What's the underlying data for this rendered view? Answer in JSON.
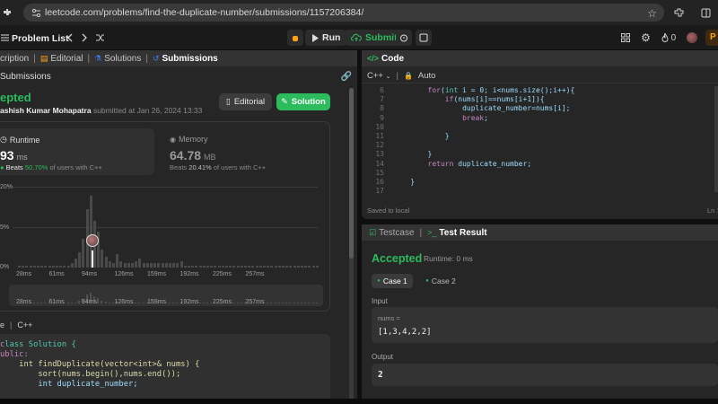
{
  "browser": {
    "url": "leetcode.com/problems/find-the-duplicate-number/submissions/1157206384/"
  },
  "header": {
    "problem_list": "Problem List",
    "run": "Run",
    "submit": "Submit"
  },
  "left_tabs": {
    "description": "cription",
    "editorial": "Editorial",
    "solutions": "Solutions",
    "submissions": "Submissions",
    "sub_heading": "Submissions"
  },
  "result": {
    "status": "epted",
    "author": "ashish Kumar Mohapatra",
    "submitted_text": "submitted at Jan 26, 2024 13:33",
    "editorial_btn": "Editorial",
    "solution_btn": "Solution"
  },
  "runtime": {
    "label": "Runtime",
    "value": "93",
    "unit": "ms",
    "beats_prefix": "Beats",
    "beats_pct": "50.70%",
    "beats_suffix": "of users with C++"
  },
  "memory": {
    "label": "Memory",
    "value": "64.78",
    "unit": "MB",
    "beats_prefix": "Beats",
    "beats_pct": "20.41%",
    "beats_suffix": "of users with C++"
  },
  "histogram": {
    "y_ticks": [
      "20%",
      "5%",
      "0%"
    ],
    "x_ticks": [
      "28ms",
      "61ms",
      "94ms",
      "126ms",
      "159ms",
      "192ms",
      "225ms",
      "257ms"
    ],
    "minimap_ticks": [
      "28ms",
      "61ms",
      "94ms",
      "126ms",
      "159ms",
      "192ms",
      "225ms",
      "257ms"
    ],
    "bar_values": [
      1,
      1,
      1,
      1,
      1,
      1,
      1,
      1,
      1,
      1,
      1,
      1,
      1,
      1,
      2,
      4,
      7,
      13,
      26,
      32,
      21,
      16,
      8,
      5,
      3,
      2,
      6,
      3,
      2,
      2,
      2,
      3,
      4,
      2,
      2,
      2,
      2,
      2,
      2,
      2,
      2,
      2,
      2,
      3,
      1,
      1,
      1,
      1,
      1,
      1,
      1,
      1,
      1,
      1,
      1,
      1,
      1,
      1,
      1,
      1,
      1,
      1,
      1,
      1,
      1,
      1,
      1,
      1,
      1,
      1,
      1,
      1,
      1,
      1,
      1,
      1,
      1,
      1,
      1,
      1
    ]
  },
  "left_code": {
    "lang_prev": "e",
    "lang": "C++",
    "lines": [
      "lass Solution {",
      "ublic:",
      "    int findDuplicate(vector<int>& nums) {",
      "        sort(nums.begin(),nums.end());",
      "        int duplicate_number;"
    ]
  },
  "code_panel": {
    "title": "Code",
    "lang": "C++",
    "mode": "Auto",
    "saved": "Saved to local",
    "pos": "Ln 1",
    "line_numbers": [
      "6",
      "7",
      "8",
      "9",
      "10",
      "11",
      "12",
      "13",
      "14",
      "15",
      "16",
      "17"
    ],
    "lines": [
      "        for(int i = 0; i<nums.size();i++){",
      "            if(nums[i]==nums[i+1]){",
      "                duplicate_number=nums[i];",
      "                break;",
      "",
      "            }",
      "",
      "        }",
      "        return duplicate_number;",
      "",
      "    }",
      ""
    ]
  },
  "test_panel": {
    "testcase_tab": "Testcase",
    "result_tab": "Test Result",
    "status": "Accepted",
    "runtime": "Runtime: 0 ms",
    "case1": "Case 1",
    "case2": "Case 2",
    "input_label": "Input",
    "param_name": "nums =",
    "param_value": "[1,3,4,2,2]",
    "output_label": "Output",
    "output_value": "2"
  },
  "colors": {
    "accent_green": "#2cbb5d",
    "accent_orange": "#ffa116",
    "bg": "#0f0f0f",
    "panel": "#262626"
  }
}
